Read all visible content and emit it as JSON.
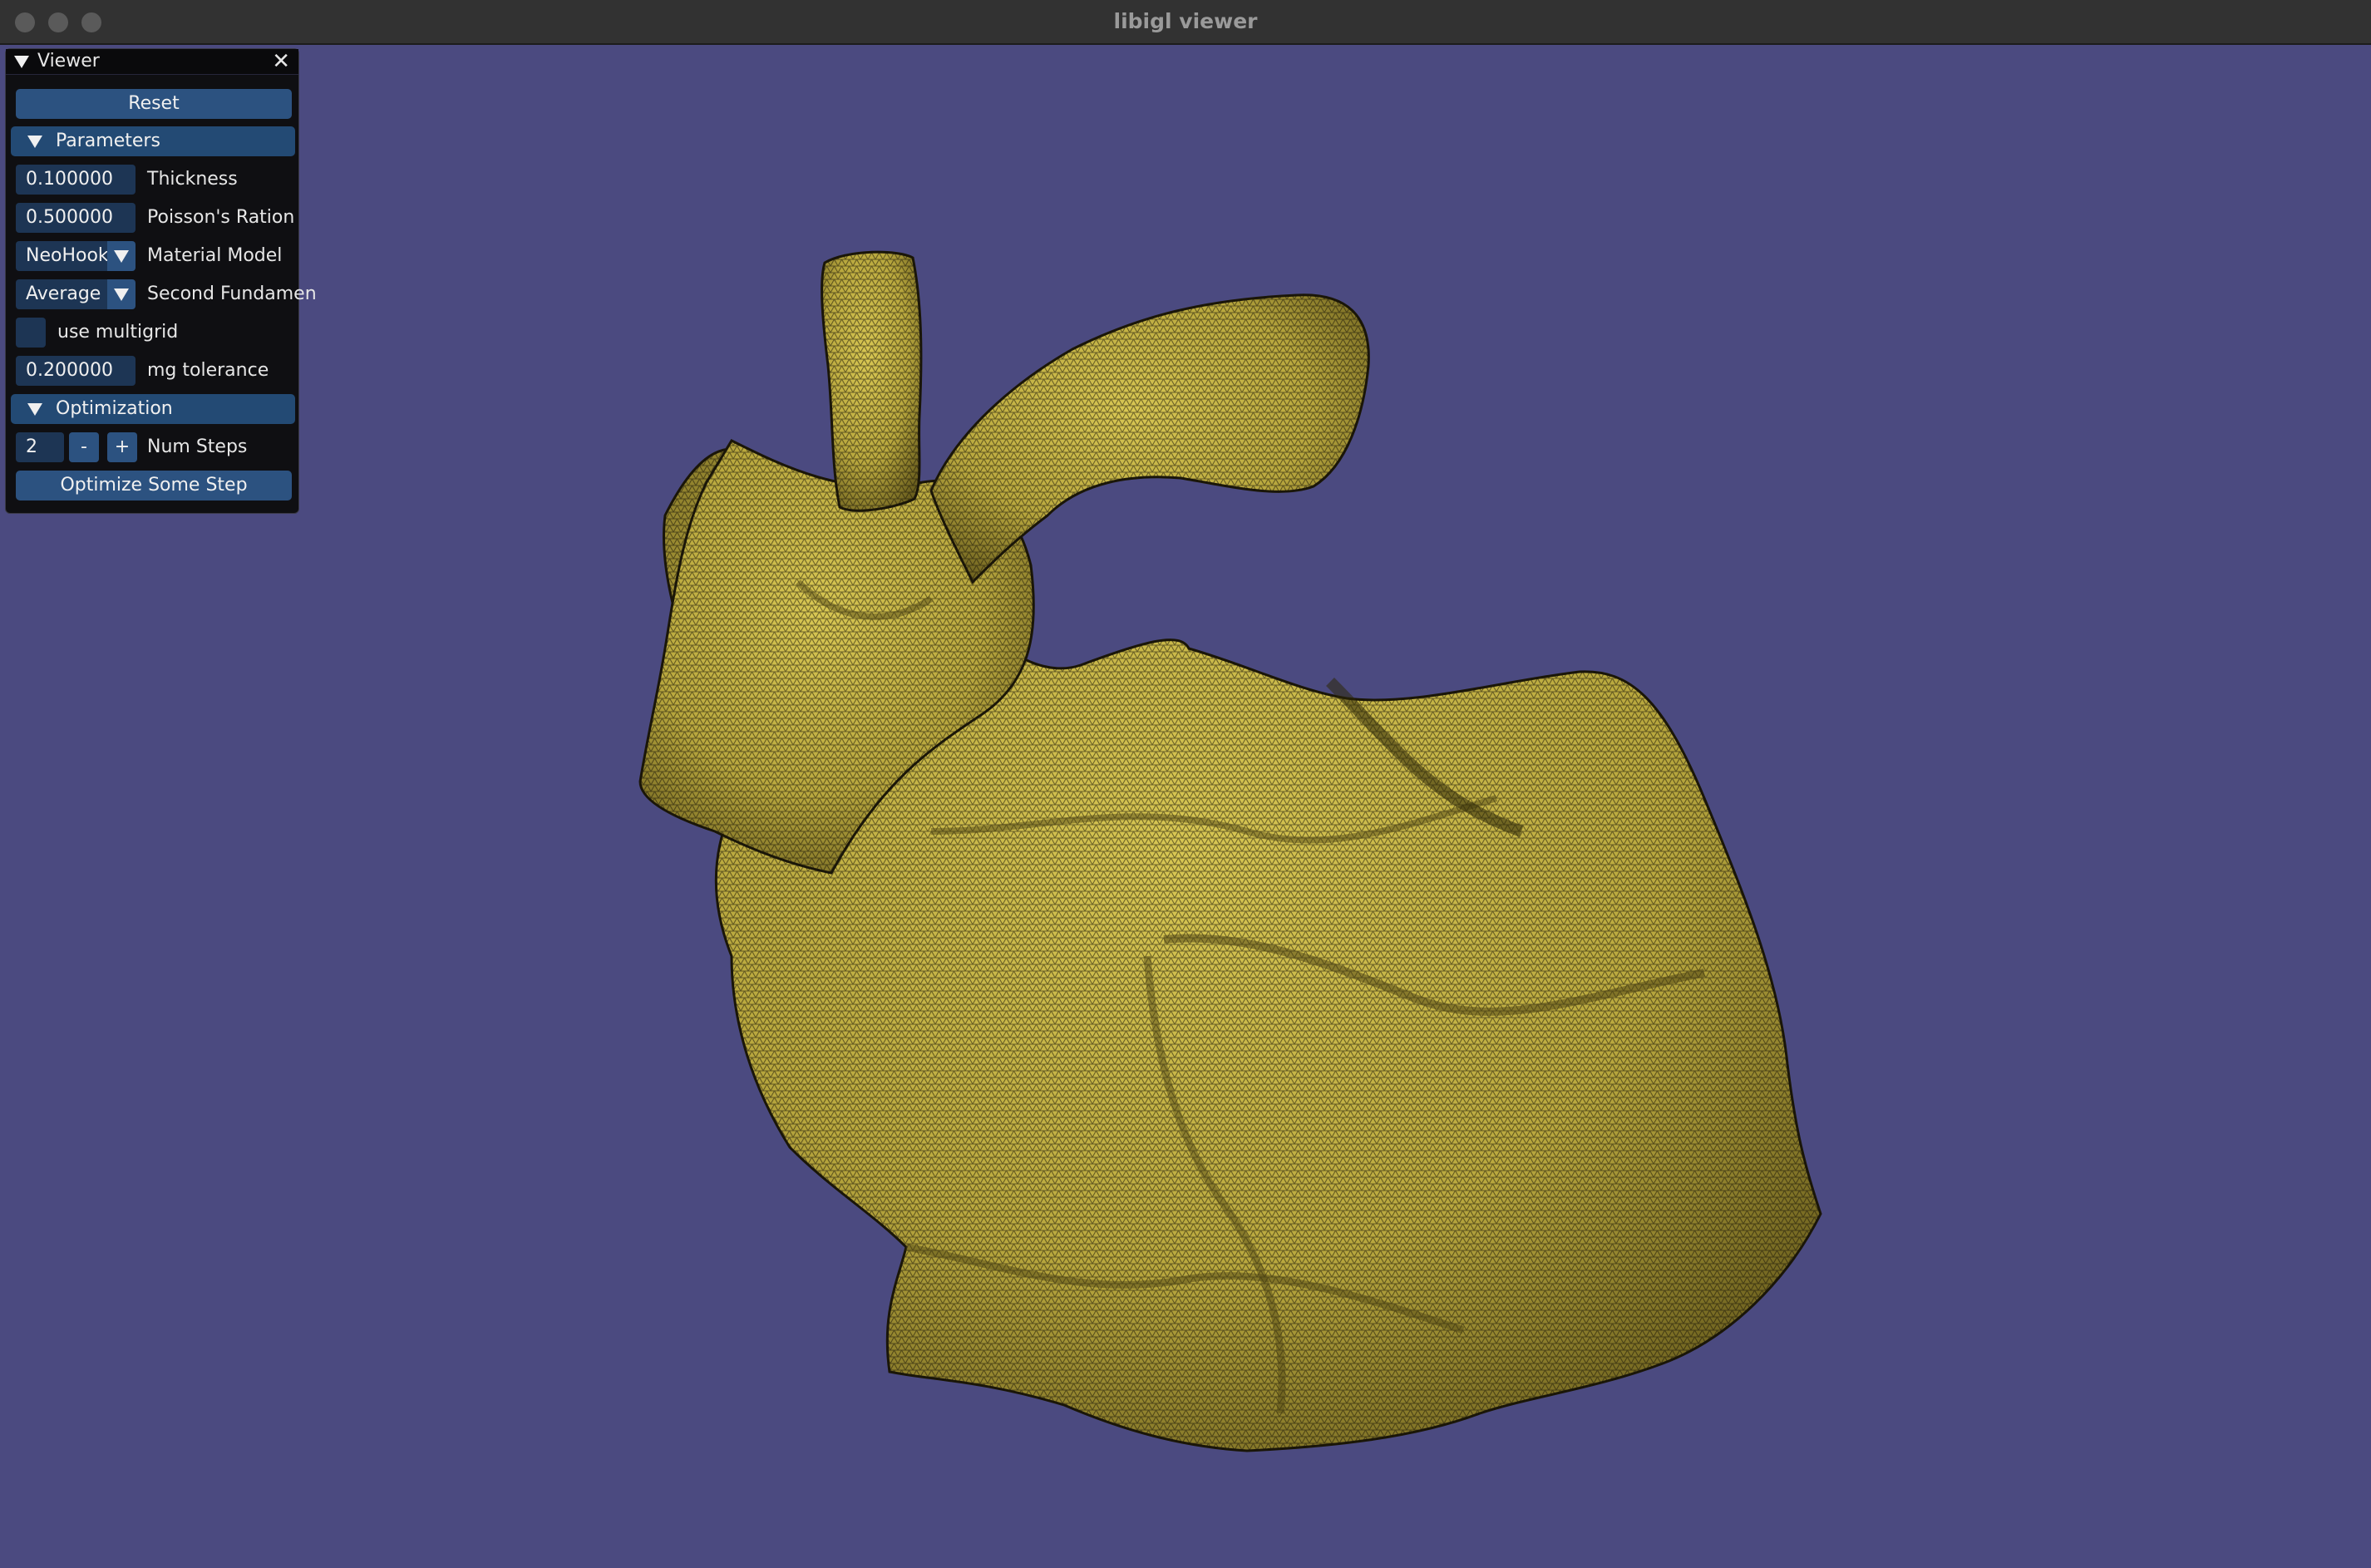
{
  "window": {
    "title": "libigl viewer",
    "background_color": "#4b4a80",
    "mesh_color": "#c9b848"
  },
  "panel": {
    "title": "Viewer",
    "reset_label": "Reset",
    "parameters": {
      "header": "Parameters",
      "thickness": {
        "value": "0.100000",
        "label": "Thickness"
      },
      "poisson": {
        "value": "0.500000",
        "label": "Poisson's Ration"
      },
      "material_model": {
        "value": "NeoHooke",
        "label": "Material Model"
      },
      "second_fundamental": {
        "value": "Average",
        "label": "Second Fundamen"
      },
      "use_multigrid": {
        "checked": false,
        "label": "use multigrid"
      },
      "mg_tolerance": {
        "value": "0.200000",
        "label": "mg tolerance"
      }
    },
    "optimization": {
      "header": "Optimization",
      "num_steps": {
        "value": "2",
        "minus": "-",
        "plus": "+",
        "label": "Num Steps"
      },
      "optimize_label": "Optimize Some Step"
    }
  }
}
